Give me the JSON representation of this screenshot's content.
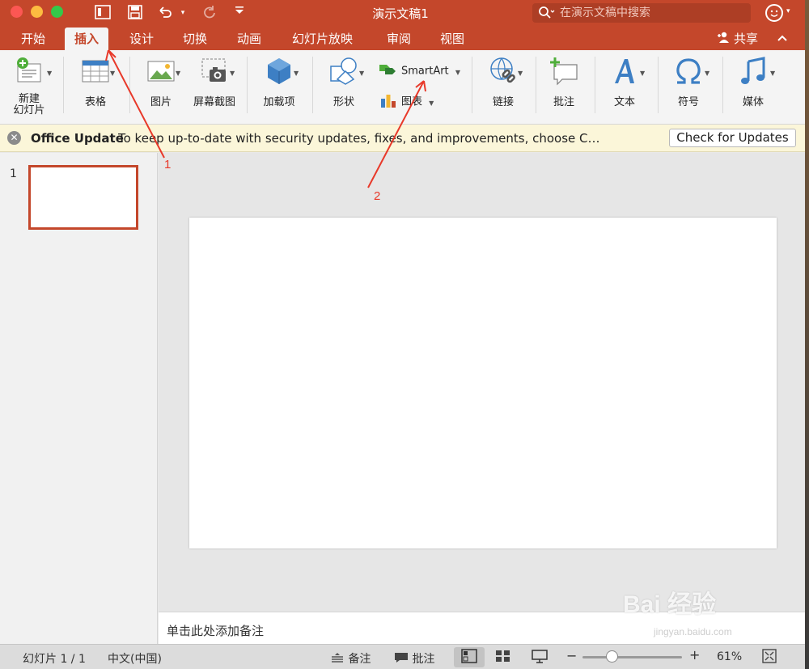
{
  "window": {
    "title": "演示文稿1",
    "search_placeholder": "在演示文稿中搜索"
  },
  "tabs": [
    {
      "label": "开始"
    },
    {
      "label": "插入"
    },
    {
      "label": "设计"
    },
    {
      "label": "切换"
    },
    {
      "label": "动画"
    },
    {
      "label": "幻灯片放映"
    },
    {
      "label": "审阅"
    },
    {
      "label": "视图"
    }
  ],
  "active_tab": "插入",
  "share_label": "共享",
  "ribbon": {
    "new_slide_line1": "新建",
    "new_slide_line2": "幻灯片",
    "table": "表格",
    "picture": "图片",
    "screenshot": "屏幕截图",
    "addins": "加载项",
    "shapes": "形状",
    "smartart": "SmartArt",
    "chart": "图表",
    "link": "链接",
    "comment": "批注",
    "text": "文本",
    "symbol": "符号",
    "media": "媒体"
  },
  "update_bar": {
    "title": "Office Update",
    "message": "To keep up-to-date with security updates, fixes, and improvements, choose Check for...",
    "button": "Check for Updates"
  },
  "slides_panel": {
    "slide_number": "1"
  },
  "notes_placeholder": "单击此处添加备注",
  "status": {
    "slide_indicator": "幻灯片 1 / 1",
    "language": "中文(中国)",
    "notes_button": "备注",
    "comments_button": "批注",
    "zoom_percent": "61%",
    "zoom_level": 0.3
  },
  "annotations": {
    "label_1": "1",
    "label_2": "2",
    "color": "#e8392a"
  },
  "watermark": {
    "main": "Bai 经验",
    "sub": "jingyan.baidu.com"
  },
  "colors": {
    "accent": "#c4472b"
  }
}
